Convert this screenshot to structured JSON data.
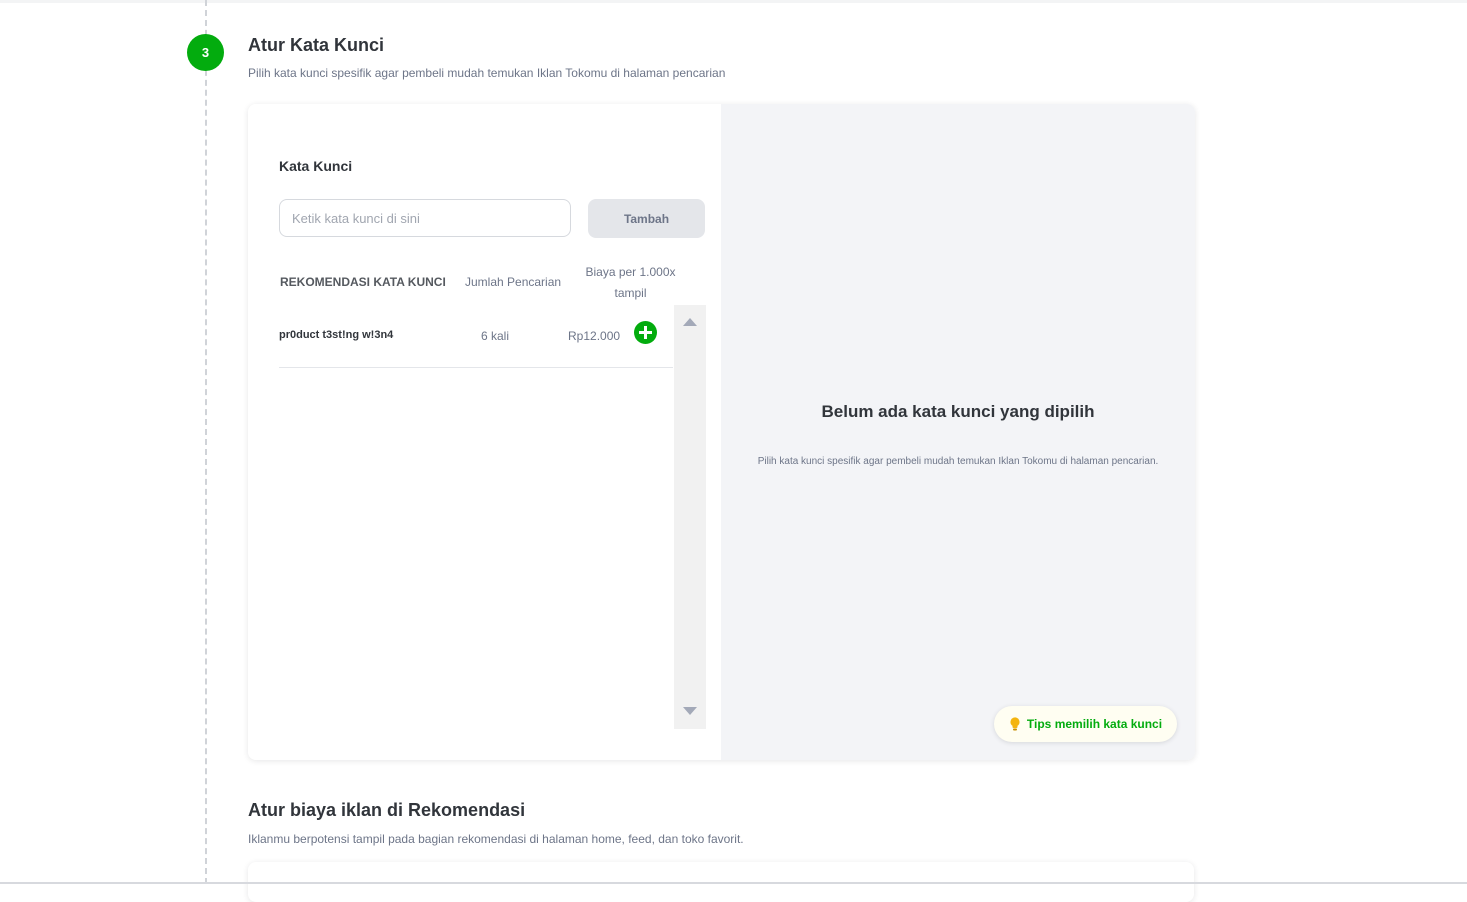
{
  "step": {
    "number": "3",
    "title": "Atur Kata Kunci",
    "description": "Pilih kata kunci spesifik agar pembeli mudah temukan Iklan Tokomu di halaman pencarian"
  },
  "keyword_form": {
    "label": "Kata Kunci",
    "input_placeholder": "Ketik kata kunci di sini",
    "input_value": "",
    "add_button": "Tambah"
  },
  "recommendations": {
    "headers": {
      "keyword": "REKOMENDASI KATA KUNCI",
      "searches": "Jumlah Pencarian",
      "cost": "Biaya per 1.000x tampil"
    },
    "rows": [
      {
        "keyword": "pr0duct t3st!ng w!3n4",
        "searches": "6 kali",
        "cost": "Rp12.000",
        "action_icon": "plus-circle-icon"
      }
    ]
  },
  "selected_panel": {
    "empty_title": "Belum ada kata kunci yang dipilih",
    "empty_description": "Pilih kata kunci spesifik agar pembeli mudah temukan Iklan Tokomu di halaman pencarian.",
    "tips_icon": "lightbulb-icon",
    "tips_label": "Tips memilih kata kunci"
  },
  "next_section": {
    "title": "Atur biaya iklan di Rekomendasi",
    "description": "Iklanmu berpotensi tampil pada bagian rekomendasi di halaman home, feed, dan toko favorit."
  },
  "colors": {
    "accent_green": "#03ac0e",
    "tips_background": "#fffef2",
    "right_panel_background": "#f3f4f7"
  }
}
